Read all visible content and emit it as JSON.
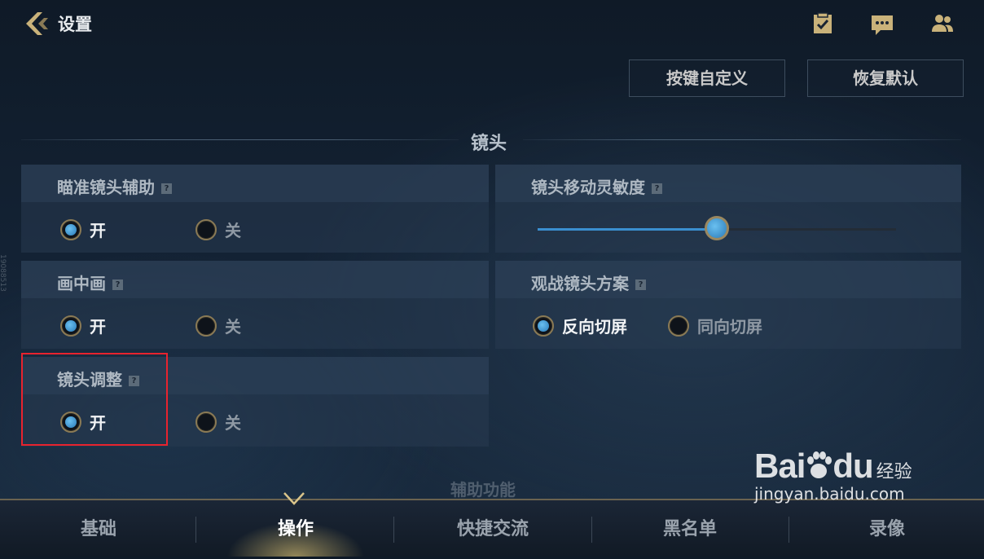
{
  "header": {
    "title": "设置",
    "icons": [
      "back-icon",
      "checklist-icon",
      "chat-icon",
      "friends-icon"
    ]
  },
  "top_buttons": {
    "custom_keys": "按键自定义",
    "restore_default": "恢复默认"
  },
  "section": {
    "title": "镜头",
    "next_title": "辅助功能"
  },
  "settings": {
    "aim_assist": {
      "label": "瞄准镜头辅助",
      "on": "开",
      "off": "关",
      "selected": "开"
    },
    "camera_sensitivity": {
      "label": "镜头移动灵敏度",
      "value_fraction": 0.5
    },
    "picture_in_picture": {
      "label": "画中画",
      "on": "开",
      "off": "关",
      "selected": "开"
    },
    "spectate_camera": {
      "label": "观战镜头方案",
      "opt1": "反向切屏",
      "opt2": "同向切屏",
      "selected": "反向切屏"
    },
    "camera_adjust": {
      "label": "镜头调整",
      "on": "开",
      "off": "关",
      "selected": "开"
    }
  },
  "help_glyph": "?",
  "tabs": [
    {
      "label": "基础"
    },
    {
      "label": "操作",
      "active": true
    },
    {
      "label": "快捷交流"
    },
    {
      "label": "黑名单"
    },
    {
      "label": "录像"
    }
  ],
  "watermark": {
    "logo": "Bai",
    "logo_tail": "du",
    "logo_cn": "经验",
    "url": "jingyan.baidu.com"
  },
  "side_id": "19088513",
  "colors": {
    "accent_blue": "#3a8fd0",
    "highlight_red": "#e8232e",
    "gold": "#c9b27a"
  }
}
